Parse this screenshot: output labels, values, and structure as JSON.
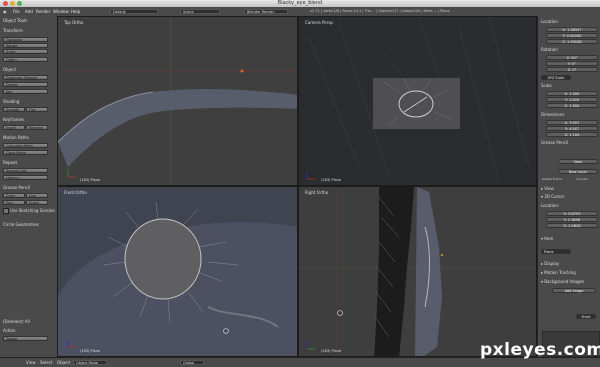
{
  "window": {
    "title": "Blacky_eye_blend"
  },
  "menu": {
    "items": [
      "File",
      "Add",
      "Render",
      "Window",
      "Help"
    ],
    "layout": "Default",
    "scene": "Scene",
    "engine": "Blender Render",
    "stats": "v2.71 | Verts:2/8 | Faces:1/11 | Tris:... | Objects:1/7 | Lamps:0/0 | Mem:... | Plane"
  },
  "tools": {
    "header": "Object Tools",
    "sections": [
      {
        "title": "Transform",
        "buttons": [
          "Translate",
          "Rotate",
          "Scale",
          "Origin"
        ]
      },
      {
        "title": "Object",
        "buttons": [
          "Duplicate Objects",
          "Delete",
          "Join"
        ]
      },
      {
        "title": "Shading",
        "buttons": [
          "Smooth",
          "Flat"
        ]
      },
      {
        "title": "Keyframes",
        "buttons": [
          "Insert",
          "Remove"
        ]
      },
      {
        "title": "Motion Paths",
        "buttons": [
          "Calculate Paths",
          "Clear Paths"
        ]
      },
      {
        "title": "Repeat",
        "buttons": [
          "Repeat Last",
          "History..."
        ]
      },
      {
        "title": "Grease Pencil",
        "buttons": [
          "Draw",
          "Line",
          "Poly",
          "Erase"
        ]
      }
    ],
    "sketching": "Use Sketching Session",
    "circle": "Circle Geometries",
    "operator": "(Deselect) All",
    "action_label": "Action",
    "action_value": "Toggle"
  },
  "viewports": [
    {
      "label": "Top Ortho",
      "object": "(183) Plane"
    },
    {
      "label": "Camera Persp",
      "object": "(183) Plane"
    },
    {
      "label": "Front Ortho",
      "object": "(183) Plane"
    },
    {
      "label": "Right Ortho",
      "object": "(183) Plane"
    }
  ],
  "status": {
    "items": [
      "View",
      "Select",
      "Object"
    ],
    "mode": "Object Mode",
    "pivot": "Global"
  },
  "properties": {
    "location": {
      "label": "Location",
      "x": "X: 1.38557",
      "y": "Y: 0.00000",
      "z": "Z: 1.39048"
    },
    "rotation": {
      "label": "Rotation",
      "x": "X: 90°",
      "y": "Y: 0°",
      "z": "Z: 0°",
      "mode": "XYZ Euler"
    },
    "scale": {
      "label": "Scale",
      "x": "X: 1.000",
      "y": "Y: 1.000",
      "z": "Z: 1.000"
    },
    "dimensions": {
      "label": "Dimensions",
      "x": "X: 3.957",
      "y": "Y: 4.547",
      "z": "Z: 1.184"
    },
    "grease": {
      "label": "Grease Pencil",
      "new": "New",
      "new_layer": "New Layer",
      "delete": "Delete Frame",
      "convert": "Convert"
    },
    "view": "View",
    "cursor": {
      "label": "3D Cursor",
      "loc": "Location:",
      "x": "X: 0.8753",
      "y": "Y: 2.3698",
      "z": "Z: 2.5626"
    },
    "item": {
      "label": "Item",
      "name": "Plane"
    },
    "display": "Display",
    "motion": "Motion Tracking",
    "bg": {
      "label": "Background Images",
      "add": "Add Image",
      "front": "Front"
    }
  },
  "watermark": "pxleyes.com"
}
